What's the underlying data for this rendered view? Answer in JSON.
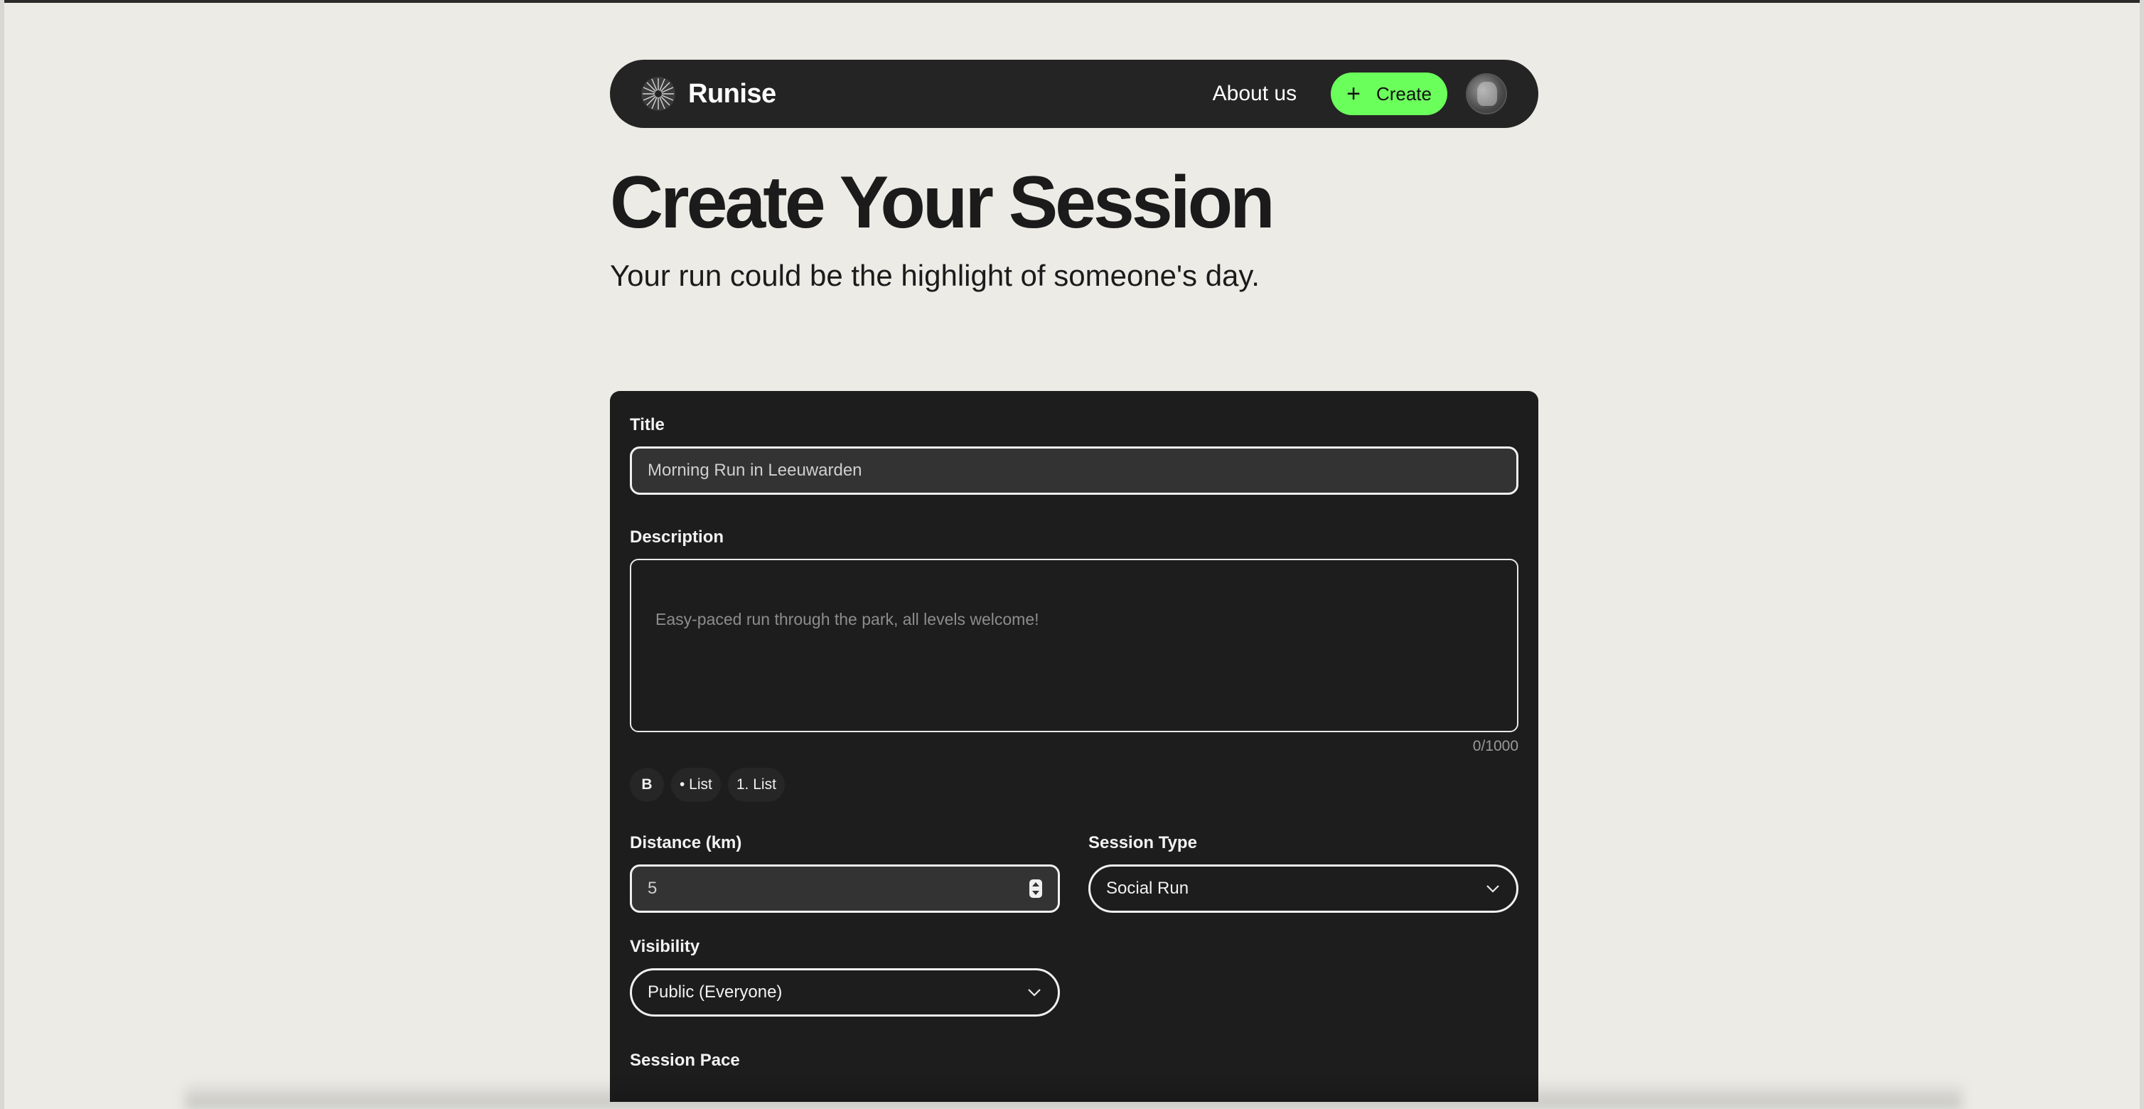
{
  "nav": {
    "brand": "Runise",
    "about_label": "About us",
    "create_label": "Create",
    "create_icon": "plus-icon",
    "logo_icon": "starburst-logo-icon",
    "avatar_icon": "user-avatar"
  },
  "header": {
    "title": "Create Your Session",
    "subtitle": "Your run could be the highlight of someone's day."
  },
  "form": {
    "title_label": "Title",
    "title_value": "Morning Run in Leeuwarden",
    "description_label": "Description",
    "description_placeholder": "Easy-paced run through the park, all levels welcome!",
    "description_counter": "0/1000",
    "toolbar": {
      "bold": "B",
      "bullet_list": "• List",
      "numbered_list": "1. List"
    },
    "distance_label": "Distance (km)",
    "distance_value": "5",
    "session_type_label": "Session Type",
    "session_type_value": "Social Run",
    "visibility_label": "Visibility",
    "visibility_value": "Public (Everyone)",
    "pace_label": "Session Pace"
  },
  "colors": {
    "background": "#ecebe6",
    "nav_bg": "#242424",
    "accent_green": "#6bff5c",
    "card_bg": "#1d1d1d"
  }
}
